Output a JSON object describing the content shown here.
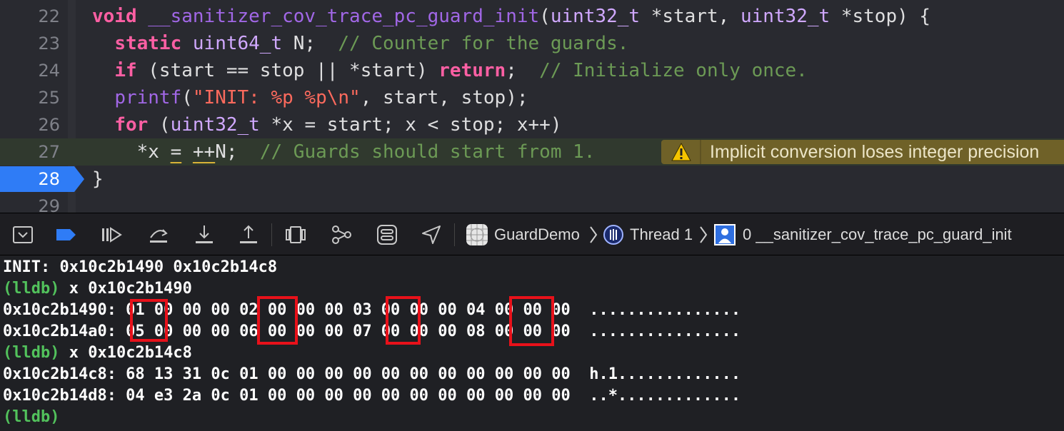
{
  "editor": {
    "lines": [
      {
        "num": "22",
        "tokens": [
          {
            "t": "void",
            "c": "kw"
          },
          {
            "t": " "
          },
          {
            "t": "__sanitizer_cov_trace_pc_guard_init",
            "c": "fn"
          },
          {
            "t": "("
          },
          {
            "t": "uint32_t",
            "c": "ty"
          },
          {
            "t": " *start, "
          },
          {
            "t": "uint32_t",
            "c": "ty"
          },
          {
            "t": " *stop) {"
          }
        ]
      },
      {
        "num": "23",
        "tokens": [
          {
            "t": "  "
          },
          {
            "t": "static",
            "c": "kw"
          },
          {
            "t": " "
          },
          {
            "t": "uint64_t",
            "c": "ty"
          },
          {
            "t": " N;  "
          },
          {
            "t": "// Counter for the guards.",
            "c": "cm"
          }
        ]
      },
      {
        "num": "24",
        "tokens": [
          {
            "t": "  "
          },
          {
            "t": "if",
            "c": "kw"
          },
          {
            "t": " (start == stop || *start) "
          },
          {
            "t": "return",
            "c": "kw"
          },
          {
            "t": ";  "
          },
          {
            "t": "// Initialize only once.",
            "c": "cm"
          }
        ]
      },
      {
        "num": "25",
        "tokens": [
          {
            "t": "  "
          },
          {
            "t": "printf",
            "c": "fn"
          },
          {
            "t": "("
          },
          {
            "t": "\"INIT: %p %p\\n\"",
            "c": "str"
          },
          {
            "t": ", start, stop);"
          }
        ]
      },
      {
        "num": "26",
        "tokens": [
          {
            "t": "  "
          },
          {
            "t": "for",
            "c": "kw"
          },
          {
            "t": " ("
          },
          {
            "t": "uint32_t",
            "c": "ty"
          },
          {
            "t": " *x = start; x < stop; x++)"
          }
        ]
      },
      {
        "num": "27",
        "current": true,
        "tokens": [
          {
            "t": "    *x "
          },
          {
            "t": "=",
            "c": "uline"
          },
          {
            "t": " "
          },
          {
            "t": "++",
            "c": "uline"
          },
          {
            "t": "N;  "
          },
          {
            "t": "// Guards should start from 1.",
            "c": "cm"
          }
        ]
      },
      {
        "num": "28",
        "active": true,
        "tokens": [
          {
            "t": "}"
          }
        ]
      },
      {
        "num": "29",
        "tokens": []
      }
    ],
    "warning": {
      "icon": "warning-triangle-icon",
      "text": "Implicit conversion loses integer precision"
    },
    "colors": {
      "keyword": "#fc5fa3",
      "type": "#d0a8ff",
      "function": "#a167e6",
      "comment": "#6c9a55",
      "string": "#fc6a5d",
      "breakpoint": "#2f7cf6",
      "warning_bg": "#6f6128"
    }
  },
  "debugbar": {
    "buttons": [
      {
        "name": "hide-debug-area-icon"
      },
      {
        "name": "breakpoints-toggle-icon"
      },
      {
        "name": "continue-icon"
      },
      {
        "name": "step-over-icon"
      },
      {
        "name": "step-into-icon"
      },
      {
        "name": "step-out-icon"
      },
      {
        "name": "view-hierarchy-icon"
      },
      {
        "name": "memory-graph-icon"
      },
      {
        "name": "environment-overrides-icon"
      },
      {
        "name": "simulate-location-icon"
      }
    ],
    "breadcrumb": {
      "app": "GuardDemo",
      "thread": "Thread 1",
      "frame": "0 __sanitizer_cov_trace_pc_guard_init"
    }
  },
  "console": {
    "lines": [
      {
        "prompt": "",
        "text": "INIT: 0x10c2b1490 0x10c2b14c8"
      },
      {
        "prompt": "(lldb)",
        "text": " x 0x10c2b1490"
      },
      {
        "prompt": "",
        "text": "0x10c2b1490: 01 00 00 00 02 00 00 00 03 00 00 00 04 00 00 00  ................"
      },
      {
        "prompt": "",
        "text": "0x10c2b14a0: 05 00 00 00 06 00 00 00 07 00 00 00 08 00 00 00  ................"
      },
      {
        "prompt": "(lldb)",
        "text": " x 0x10c2b14c8"
      },
      {
        "prompt": "",
        "text": "0x10c2b14c8: 68 13 31 0c 01 00 00 00 00 00 00 00 00 00 00 00  h.1............."
      },
      {
        "prompt": "",
        "text": "0x10c2b14d8: 04 e3 2a 0c 01 00 00 00 00 00 00 00 00 00 00 00  ..*............."
      },
      {
        "prompt": "(lldb)",
        "text": ""
      }
    ],
    "prompt_color": "#52c25c",
    "highlight_color": "#e8111a"
  }
}
